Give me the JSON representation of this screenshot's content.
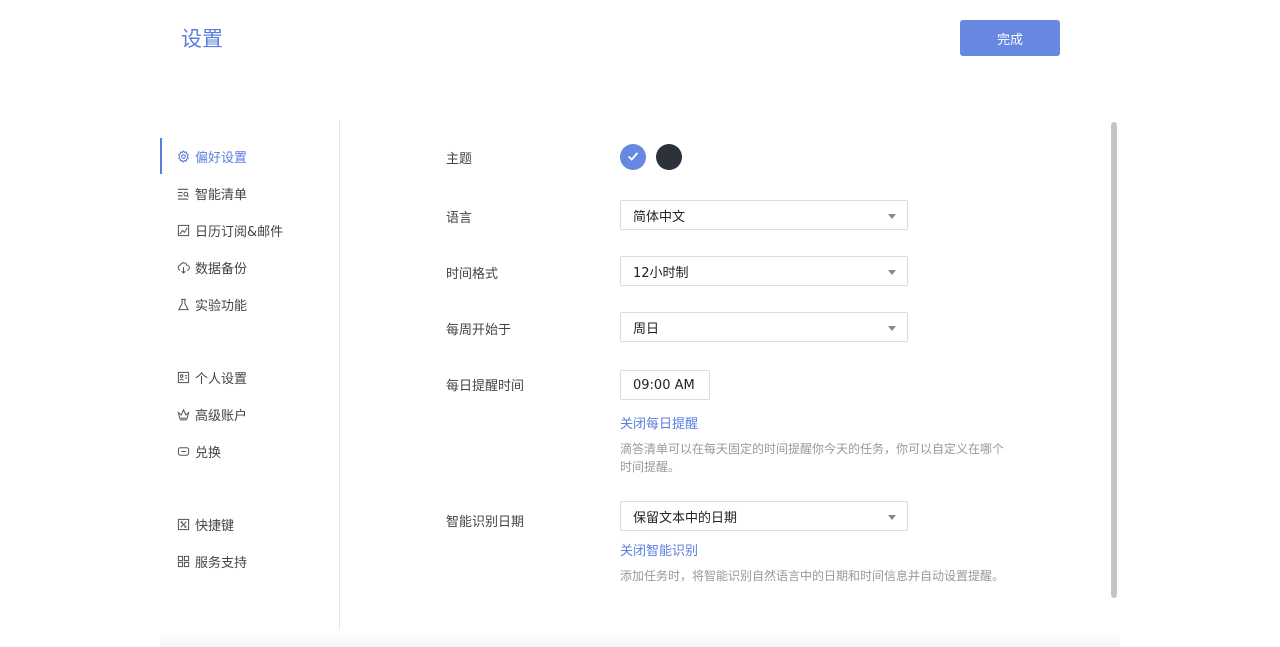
{
  "header": {
    "title": "设置",
    "done_label": "完成"
  },
  "sidebar": {
    "items": [
      {
        "label": "偏好设置",
        "icon": "gear-icon",
        "active": true
      },
      {
        "label": "智能清单",
        "icon": "smart-list-icon"
      },
      {
        "label": "日历订阅&邮件",
        "icon": "calendar-mail-icon"
      },
      {
        "label": "数据备份",
        "icon": "cloud-icon"
      },
      {
        "label": "实验功能",
        "icon": "flask-icon"
      },
      {
        "label": "个人设置",
        "icon": "profile-card-icon"
      },
      {
        "label": "高级账户",
        "icon": "crown-icon"
      },
      {
        "label": "兑换",
        "icon": "ticket-icon"
      },
      {
        "label": "快捷键",
        "icon": "keyboard-icon"
      },
      {
        "label": "服务支持",
        "icon": "grid-icon"
      }
    ]
  },
  "settings": {
    "theme": {
      "label": "主题",
      "options": [
        {
          "color": "#6688e0",
          "selected": true
        },
        {
          "color": "#2d3139",
          "selected": false
        }
      ]
    },
    "language": {
      "label": "语言",
      "value": "简体中文"
    },
    "time_format": {
      "label": "时间格式",
      "value": "12小时制"
    },
    "week_start": {
      "label": "每周开始于",
      "value": "周日"
    },
    "daily_reminder": {
      "label": "每日提醒时间",
      "value": "09:00 AM",
      "link": "关闭每日提醒",
      "description": "滴答清单可以在每天固定的时间提醒你今天的任务，你可以自定义在哪个时间提醒。"
    },
    "smart_date": {
      "label": "智能识别日期",
      "value": "保留文本中的日期",
      "link": "关闭智能识别",
      "description": "添加任务时，将智能识别自然语言中的日期和时间信息并自动设置提醒。"
    }
  },
  "colors": {
    "accent": "#5b7de0",
    "button": "#6688e0"
  }
}
